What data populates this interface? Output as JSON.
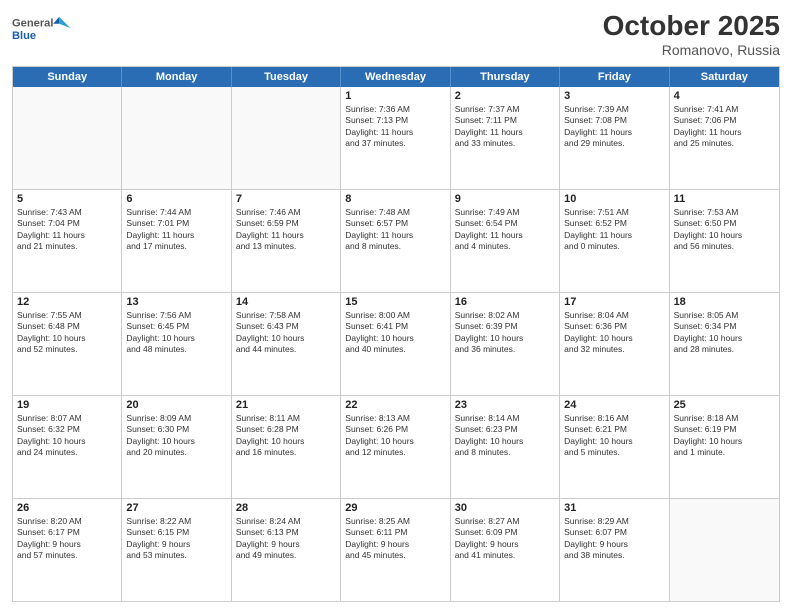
{
  "header": {
    "logo_line1": "General",
    "logo_line2": "Blue",
    "month": "October 2025",
    "location": "Romanovo, Russia"
  },
  "days_of_week": [
    "Sunday",
    "Monday",
    "Tuesday",
    "Wednesday",
    "Thursday",
    "Friday",
    "Saturday"
  ],
  "weeks": [
    [
      {
        "day": "",
        "info": ""
      },
      {
        "day": "",
        "info": ""
      },
      {
        "day": "",
        "info": ""
      },
      {
        "day": "1",
        "info": "Sunrise: 7:36 AM\nSunset: 7:13 PM\nDaylight: 11 hours\nand 37 minutes."
      },
      {
        "day": "2",
        "info": "Sunrise: 7:37 AM\nSunset: 7:11 PM\nDaylight: 11 hours\nand 33 minutes."
      },
      {
        "day": "3",
        "info": "Sunrise: 7:39 AM\nSunset: 7:08 PM\nDaylight: 11 hours\nand 29 minutes."
      },
      {
        "day": "4",
        "info": "Sunrise: 7:41 AM\nSunset: 7:06 PM\nDaylight: 11 hours\nand 25 minutes."
      }
    ],
    [
      {
        "day": "5",
        "info": "Sunrise: 7:43 AM\nSunset: 7:04 PM\nDaylight: 11 hours\nand 21 minutes."
      },
      {
        "day": "6",
        "info": "Sunrise: 7:44 AM\nSunset: 7:01 PM\nDaylight: 11 hours\nand 17 minutes."
      },
      {
        "day": "7",
        "info": "Sunrise: 7:46 AM\nSunset: 6:59 PM\nDaylight: 11 hours\nand 13 minutes."
      },
      {
        "day": "8",
        "info": "Sunrise: 7:48 AM\nSunset: 6:57 PM\nDaylight: 11 hours\nand 8 minutes."
      },
      {
        "day": "9",
        "info": "Sunrise: 7:49 AM\nSunset: 6:54 PM\nDaylight: 11 hours\nand 4 minutes."
      },
      {
        "day": "10",
        "info": "Sunrise: 7:51 AM\nSunset: 6:52 PM\nDaylight: 11 hours\nand 0 minutes."
      },
      {
        "day": "11",
        "info": "Sunrise: 7:53 AM\nSunset: 6:50 PM\nDaylight: 10 hours\nand 56 minutes."
      }
    ],
    [
      {
        "day": "12",
        "info": "Sunrise: 7:55 AM\nSunset: 6:48 PM\nDaylight: 10 hours\nand 52 minutes."
      },
      {
        "day": "13",
        "info": "Sunrise: 7:56 AM\nSunset: 6:45 PM\nDaylight: 10 hours\nand 48 minutes."
      },
      {
        "day": "14",
        "info": "Sunrise: 7:58 AM\nSunset: 6:43 PM\nDaylight: 10 hours\nand 44 minutes."
      },
      {
        "day": "15",
        "info": "Sunrise: 8:00 AM\nSunset: 6:41 PM\nDaylight: 10 hours\nand 40 minutes."
      },
      {
        "day": "16",
        "info": "Sunrise: 8:02 AM\nSunset: 6:39 PM\nDaylight: 10 hours\nand 36 minutes."
      },
      {
        "day": "17",
        "info": "Sunrise: 8:04 AM\nSunset: 6:36 PM\nDaylight: 10 hours\nand 32 minutes."
      },
      {
        "day": "18",
        "info": "Sunrise: 8:05 AM\nSunset: 6:34 PM\nDaylight: 10 hours\nand 28 minutes."
      }
    ],
    [
      {
        "day": "19",
        "info": "Sunrise: 8:07 AM\nSunset: 6:32 PM\nDaylight: 10 hours\nand 24 minutes."
      },
      {
        "day": "20",
        "info": "Sunrise: 8:09 AM\nSunset: 6:30 PM\nDaylight: 10 hours\nand 20 minutes."
      },
      {
        "day": "21",
        "info": "Sunrise: 8:11 AM\nSunset: 6:28 PM\nDaylight: 10 hours\nand 16 minutes."
      },
      {
        "day": "22",
        "info": "Sunrise: 8:13 AM\nSunset: 6:26 PM\nDaylight: 10 hours\nand 12 minutes."
      },
      {
        "day": "23",
        "info": "Sunrise: 8:14 AM\nSunset: 6:23 PM\nDaylight: 10 hours\nand 8 minutes."
      },
      {
        "day": "24",
        "info": "Sunrise: 8:16 AM\nSunset: 6:21 PM\nDaylight: 10 hours\nand 5 minutes."
      },
      {
        "day": "25",
        "info": "Sunrise: 8:18 AM\nSunset: 6:19 PM\nDaylight: 10 hours\nand 1 minute."
      }
    ],
    [
      {
        "day": "26",
        "info": "Sunrise: 8:20 AM\nSunset: 6:17 PM\nDaylight: 9 hours\nand 57 minutes."
      },
      {
        "day": "27",
        "info": "Sunrise: 8:22 AM\nSunset: 6:15 PM\nDaylight: 9 hours\nand 53 minutes."
      },
      {
        "day": "28",
        "info": "Sunrise: 8:24 AM\nSunset: 6:13 PM\nDaylight: 9 hours\nand 49 minutes."
      },
      {
        "day": "29",
        "info": "Sunrise: 8:25 AM\nSunset: 6:11 PM\nDaylight: 9 hours\nand 45 minutes."
      },
      {
        "day": "30",
        "info": "Sunrise: 8:27 AM\nSunset: 6:09 PM\nDaylight: 9 hours\nand 41 minutes."
      },
      {
        "day": "31",
        "info": "Sunrise: 8:29 AM\nSunset: 6:07 PM\nDaylight: 9 hours\nand 38 minutes."
      },
      {
        "day": "",
        "info": ""
      }
    ]
  ]
}
